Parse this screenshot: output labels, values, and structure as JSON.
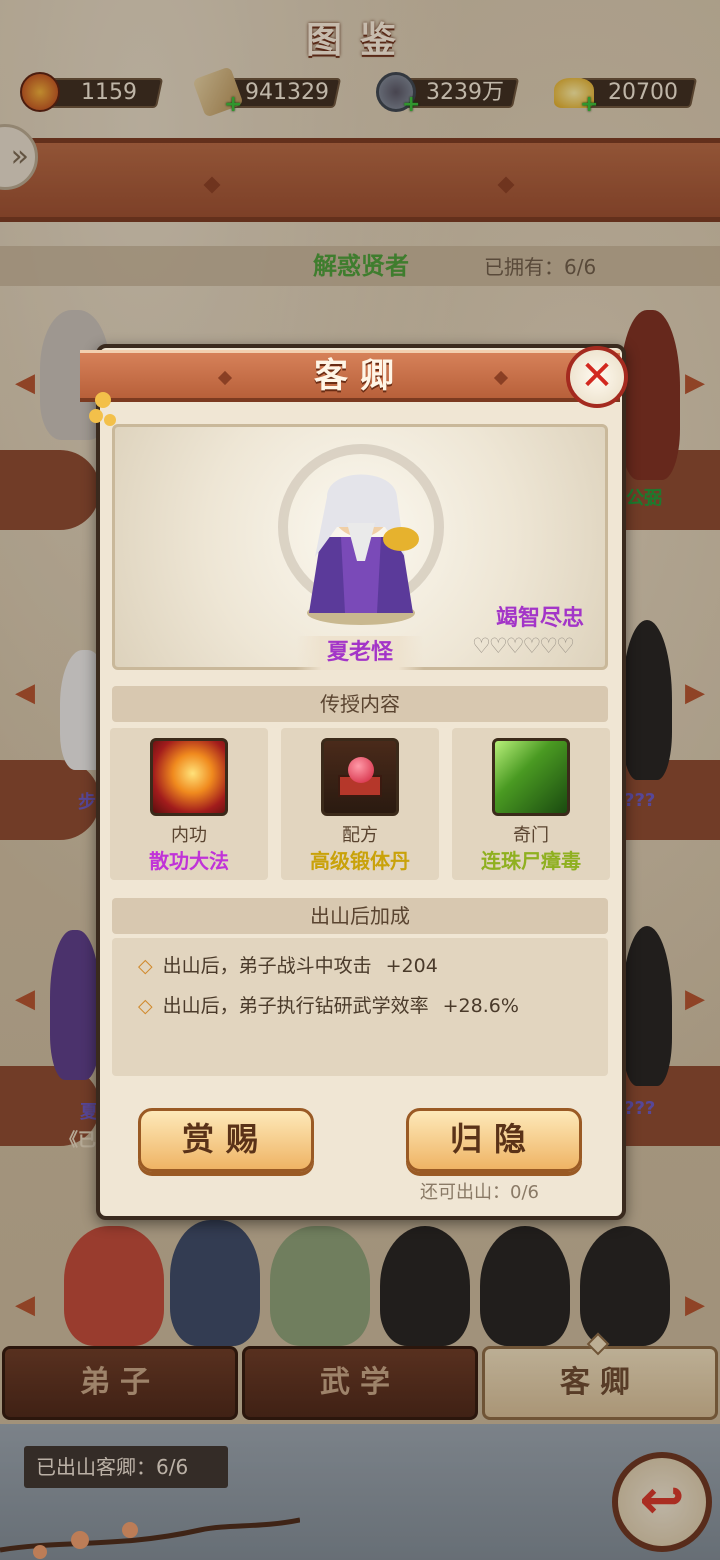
{
  "currency": [
    {
      "icon": "dragon-emblem-icon",
      "value": "1159"
    },
    {
      "icon": "scroll-icon",
      "value": "941329"
    },
    {
      "icon": "copper-coin-icon",
      "value": "3239万"
    },
    {
      "icon": "gold-ingot-icon",
      "value": "20700"
    }
  ],
  "header": {
    "title": "图鉴"
  },
  "section": {
    "name": "解惑贤者",
    "owned": "已拥有：6/6"
  },
  "background_labels": {
    "right_top": "公弼",
    "left_mid": "步",
    "right_mid": "???",
    "left_low": "夏",
    "right_low": "???",
    "left_low2": "《已"
  },
  "modal": {
    "title": "客卿",
    "character_name": "夏老怪",
    "loyalty_label": "竭智尽忠",
    "hearts": "♡♡♡♡♡♡",
    "teach_header": "传授内容",
    "skills": [
      {
        "kind": "内功",
        "name": "散功大法",
        "color": "#c033d8",
        "icon": "sun-burst-icon"
      },
      {
        "kind": "配方",
        "name": "高级锻体丹",
        "color": "#c9a20a",
        "icon": "pill-box-icon"
      },
      {
        "kind": "奇门",
        "name": "连珠尸瘴毒",
        "color": "#8fb020",
        "icon": "poison-bolts-icon"
      }
    ],
    "bonus_header": "出山后加成",
    "bonuses": [
      {
        "text": "出山后，弟子战斗中攻击",
        "value": "+204"
      },
      {
        "text": "出山后，弟子执行钻研武学效率",
        "value": "+28.6%"
      }
    ],
    "reward_button": "赏赐",
    "retire_button": "归隐",
    "remain_text": "还可出山：0/6"
  },
  "tabs": [
    {
      "label": "弟子",
      "active": false
    },
    {
      "label": "武学",
      "active": false
    },
    {
      "label": "客卿",
      "active": true
    }
  ],
  "footer": {
    "out_count": "已出山客卿：6/6"
  },
  "colors": {
    "accent": "#b8603a",
    "loyal": "#a335c8",
    "section_green": "#4aa03a"
  }
}
